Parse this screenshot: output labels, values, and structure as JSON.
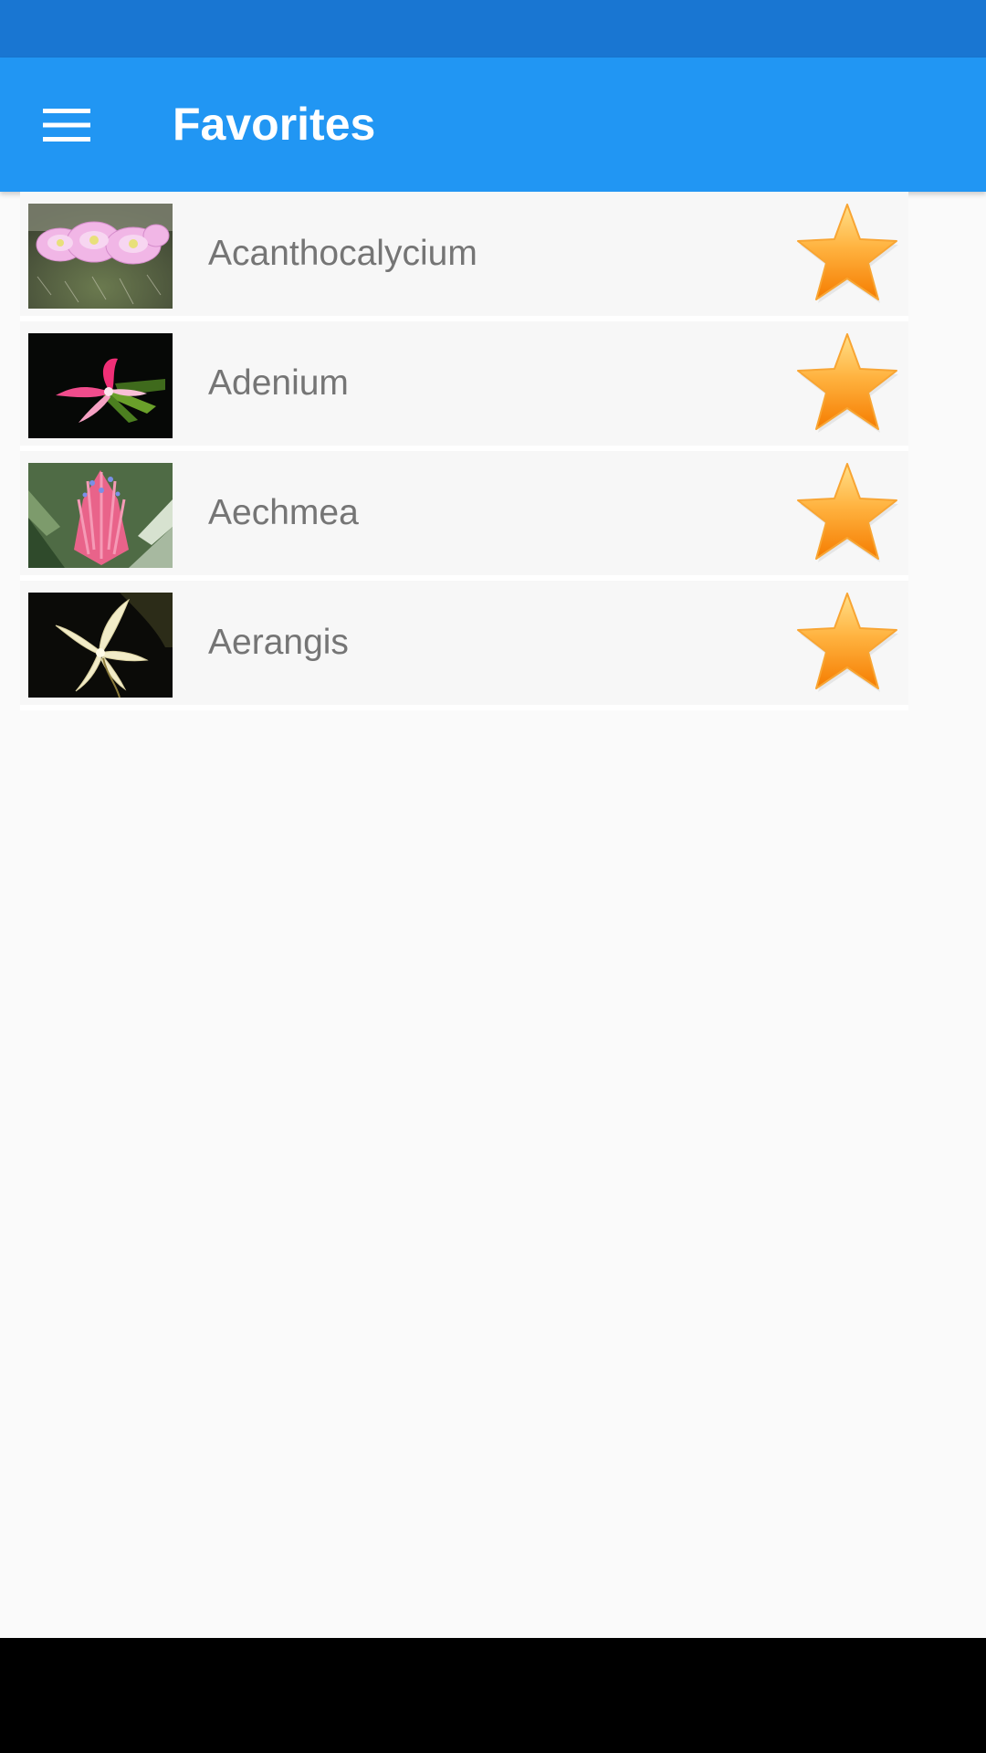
{
  "app_bar": {
    "title": "Favorites",
    "menu_icon": "hamburger-menu-icon",
    "color": "#2196f3",
    "status_bar_color": "#1976d2"
  },
  "favorites": [
    {
      "name": "Acanthocalycium",
      "thumbnail": "pink cactus flowers photo",
      "favorite": true,
      "star_icon": "star-icon"
    },
    {
      "name": "Adenium",
      "thumbnail": "pink adenium flower on black photo",
      "favorite": true,
      "star_icon": "star-icon"
    },
    {
      "name": "Aechmea",
      "thumbnail": "pink aechmea bromeliad photo",
      "favorite": true,
      "star_icon": "star-icon"
    },
    {
      "name": "Aerangis",
      "thumbnail": "white aerangis orchid photo",
      "favorite": true,
      "star_icon": "star-icon"
    }
  ],
  "colors": {
    "star": "#ffa726",
    "label": "#757575",
    "background": "#fafafa"
  }
}
